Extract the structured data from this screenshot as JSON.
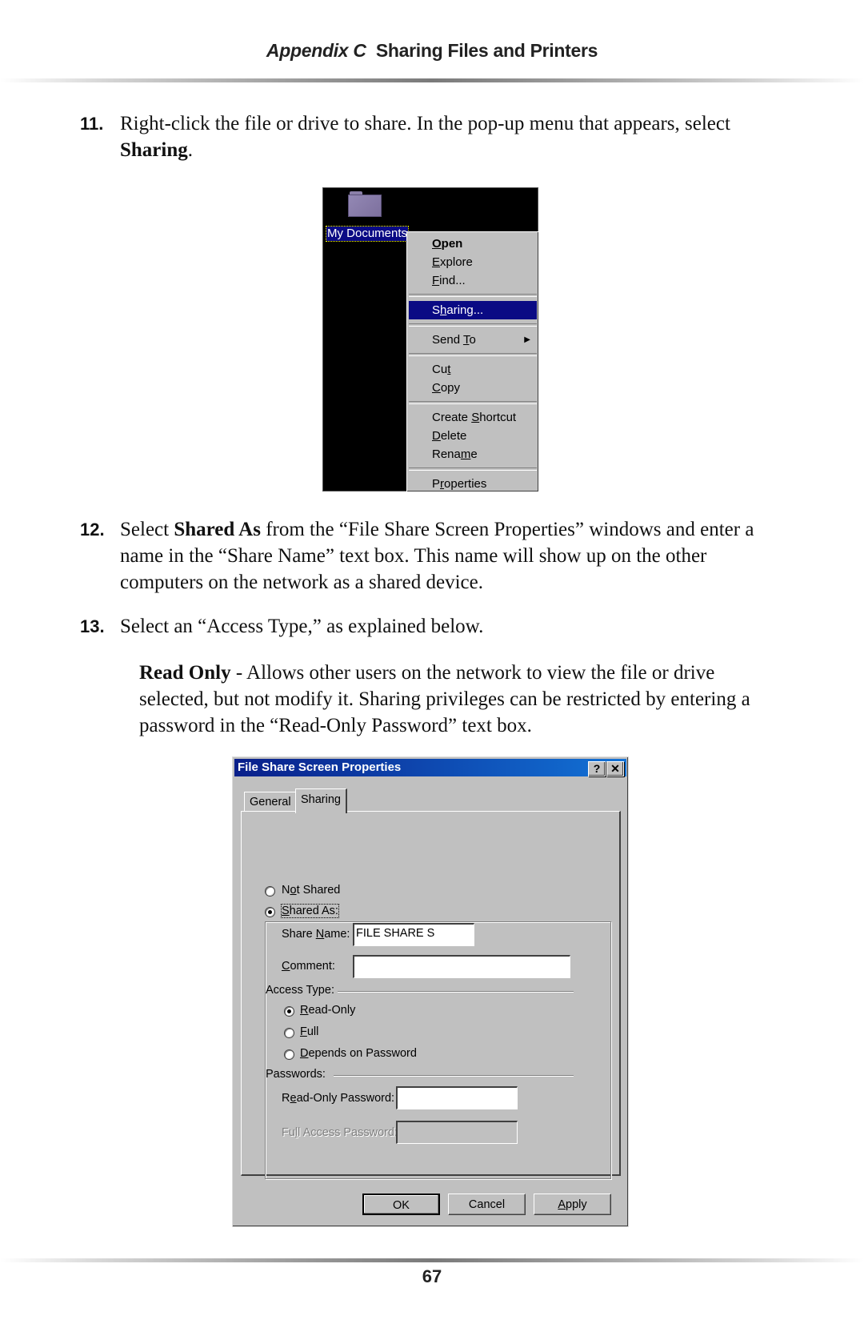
{
  "header": {
    "appendix_label": "Appendix C",
    "title": "Sharing Files and Printers"
  },
  "steps": [
    {
      "number": "11.",
      "text_before": "Right-click the file or drive to share. In the pop-up menu that appears, select ",
      "bold": "Sharing",
      "text_after": "."
    },
    {
      "number": "12.",
      "text_before": "Select ",
      "bold": "Shared As",
      "text_after": " from the “File Share Screen Properties” windows and enter a name in the “Share Name” text box. This name will show up on the other computers on the network as a shared device."
    },
    {
      "number": "13.",
      "text_before": "Select an “Access Type,” as explained below.",
      "bold": "",
      "text_after": ""
    }
  ],
  "read_only_note": {
    "bold": "Read Only",
    "text": " - Allows other users on the network to view the file or drive selected, but not modify it. Sharing privileges can be restricted by entering a password in the “Read-Only Password” text box."
  },
  "context_menu_screenshot": {
    "desktop_icon_label": "My Documents",
    "items": [
      {
        "label": "Open",
        "bold": true
      },
      {
        "label": "Explore"
      },
      {
        "label": "Find..."
      },
      {
        "separator": true
      },
      {
        "label": "Sharing...",
        "selected": true
      },
      {
        "separator": true
      },
      {
        "label": "Send To",
        "submenu": true
      },
      {
        "separator": true
      },
      {
        "label": "Cut"
      },
      {
        "label": "Copy"
      },
      {
        "separator": true
      },
      {
        "label": "Create Shortcut"
      },
      {
        "label": "Delete"
      },
      {
        "label": "Rename"
      },
      {
        "separator": true
      },
      {
        "label": "Properties"
      }
    ],
    "submenu_arrow": "▶"
  },
  "dialog": {
    "title": "File Share Screen Properties",
    "help_button": "?",
    "close_button": "✕",
    "tabs": [
      "General",
      "Sharing"
    ],
    "active_tab": "Sharing",
    "not_shared_label": "Not Shared",
    "shared_as_label": "Shared As:",
    "sharing_selected": "Shared As",
    "share_name_label": "Share Name:",
    "share_name_value": "FILE SHARE S",
    "comment_label": "Comment:",
    "comment_value": "",
    "access_type_label": "Access Type:",
    "access_options": [
      "Read-Only",
      "Full",
      "Depends on Password"
    ],
    "access_selected": "Read-Only",
    "passwords_label": "Passwords:",
    "read_only_password_label": "Read-Only Password:",
    "read_only_password_value": "",
    "full_access_password_label": "Full Access Password:",
    "full_access_password_value": "",
    "buttons": {
      "ok": "OK",
      "cancel": "Cancel",
      "apply": "Apply"
    }
  },
  "page_number": "67"
}
